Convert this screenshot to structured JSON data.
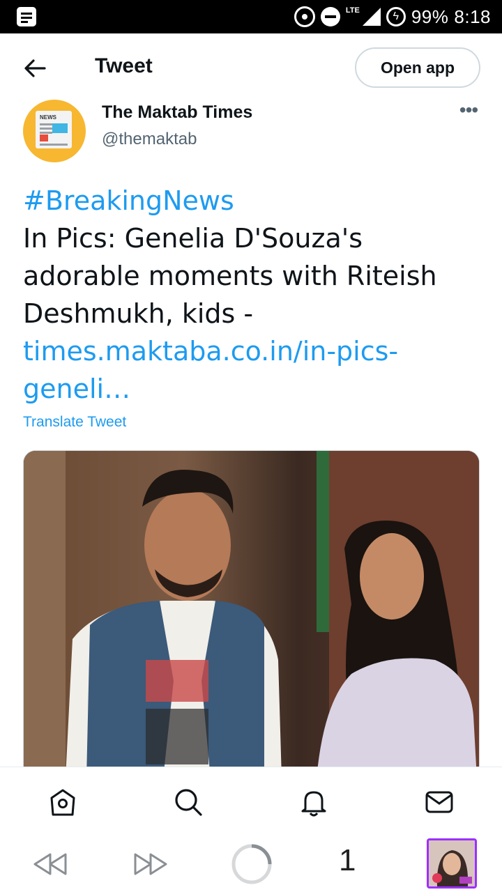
{
  "status_bar": {
    "network": "LTE",
    "battery": "99%",
    "time": "8:18"
  },
  "header": {
    "title": "Tweet",
    "open_app": "Open app"
  },
  "author": {
    "name": "The Maktab Times",
    "handle": "@themaktab",
    "avatar_text": "NEWS"
  },
  "tweet": {
    "hashtag": "#BreakingNews",
    "text": "In Pics: Genelia D'Souza's adorable moments with Riteish Deshmukh, kids -",
    "link": "times.maktaba.co.in/in-pics-geneli…",
    "translate": "Translate Tweet"
  },
  "bottom_nav": {
    "items": [
      "home-icon",
      "search-icon",
      "notifications-icon",
      "messages-icon"
    ]
  },
  "browser_bar": {
    "tab_count": "1"
  },
  "colors": {
    "accent": "#1d9bf0",
    "text": "#0f1419",
    "secondary": "#536471"
  }
}
